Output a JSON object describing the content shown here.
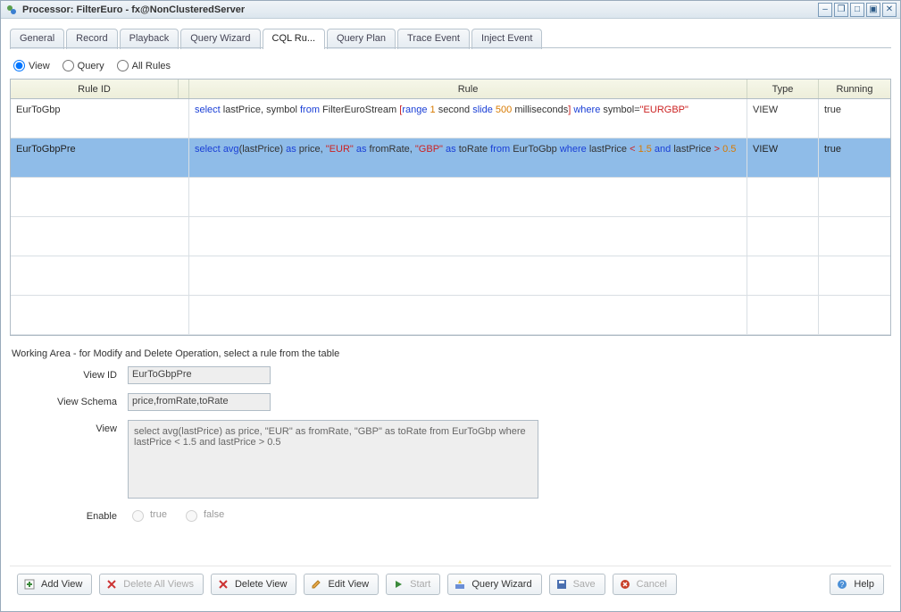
{
  "window": {
    "title": "Processor: FilterEuro - fx@NonClusteredServer"
  },
  "tabs": [
    {
      "label": "General"
    },
    {
      "label": "Record"
    },
    {
      "label": "Playback"
    },
    {
      "label": "Query Wizard"
    },
    {
      "label": "CQL Ru...",
      "active": true
    },
    {
      "label": "Query Plan"
    },
    {
      "label": "Trace Event"
    },
    {
      "label": "Inject Event"
    }
  ],
  "filter": {
    "view": "View",
    "query": "Query",
    "all": "All Rules",
    "selected": "view"
  },
  "grid": {
    "headers": {
      "ruleid": "Rule ID",
      "rule": "Rule",
      "type": "Type",
      "running": "Running"
    },
    "rows": [
      {
        "ruleid": "EurToGbp",
        "rule_plain": "select lastPrice, symbol from FilterEuroStream [range 1 second slide 500 milliseconds] where symbol=\"EURGBP\"",
        "type": "VIEW",
        "running": "true",
        "selected": false,
        "tokens": [
          {
            "t": "select",
            "c": "kw-blue"
          },
          {
            "t": " lastPrice, symbol ",
            "c": "kw-black"
          },
          {
            "t": "from",
            "c": "kw-blue"
          },
          {
            "t": " FilterEuroStream ",
            "c": "kw-black"
          },
          {
            "t": "[",
            "c": "kw-red"
          },
          {
            "t": "range",
            "c": "kw-blue"
          },
          {
            "t": " 1 ",
            "c": "kw-orange"
          },
          {
            "t": "second ",
            "c": "kw-black"
          },
          {
            "t": "slide",
            "c": "kw-blue"
          },
          {
            "t": " 500 ",
            "c": "kw-orange"
          },
          {
            "t": "milliseconds",
            "c": "kw-black"
          },
          {
            "t": "]",
            "c": "kw-red"
          },
          {
            "t": " ",
            "c": "kw-black"
          },
          {
            "t": "where",
            "c": "kw-blue"
          },
          {
            "t": " symbol=",
            "c": "kw-black"
          },
          {
            "t": "\"EURGBP\"",
            "c": "kw-red"
          }
        ]
      },
      {
        "ruleid": "EurToGbpPre",
        "rule_plain": "select avg(lastPrice) as price, \"EUR\" as fromRate, \"GBP\" as toRate from EurToGbp where lastPrice < 1.5 and lastPrice > 0.5",
        "type": "VIEW",
        "running": "true",
        "selected": true,
        "tokens": [
          {
            "t": "select",
            "c": "kw-blue"
          },
          {
            "t": " ",
            "c": "kw-black"
          },
          {
            "t": "avg",
            "c": "kw-blue"
          },
          {
            "t": "(lastPrice) ",
            "c": "kw-black"
          },
          {
            "t": "as",
            "c": "kw-blue"
          },
          {
            "t": " price, ",
            "c": "kw-black"
          },
          {
            "t": "\"EUR\"",
            "c": "kw-red"
          },
          {
            "t": " ",
            "c": "kw-black"
          },
          {
            "t": "as",
            "c": "kw-blue"
          },
          {
            "t": " fromRate, ",
            "c": "kw-black"
          },
          {
            "t": "\"GBP\"",
            "c": "kw-red"
          },
          {
            "t": " ",
            "c": "kw-black"
          },
          {
            "t": "as",
            "c": "kw-blue"
          },
          {
            "t": " toRate ",
            "c": "kw-black"
          },
          {
            "t": "from",
            "c": "kw-blue"
          },
          {
            "t": " EurToGbp ",
            "c": "kw-black"
          },
          {
            "t": "where",
            "c": "kw-blue"
          },
          {
            "t": " lastPrice ",
            "c": "kw-black"
          },
          {
            "t": "<",
            "c": "kw-red"
          },
          {
            "t": " 1.5 ",
            "c": "kw-orange"
          },
          {
            "t": "and",
            "c": "kw-blue"
          },
          {
            "t": " lastPrice ",
            "c": "kw-black"
          },
          {
            "t": ">",
            "c": "kw-red"
          },
          {
            "t": " 0.5",
            "c": "kw-orange"
          }
        ]
      }
    ],
    "empty_rows": 4
  },
  "working_area": {
    "caption": "Working Area - for Modify and Delete Operation, select a rule from the table",
    "labels": {
      "view_id": "View ID",
      "view_schema": "View Schema",
      "view": "View",
      "enable": "Enable",
      "true": "true",
      "false": "false"
    },
    "values": {
      "view_id": "EurToGbpPre",
      "view_schema": "price,fromRate,toRate",
      "view_text": "select avg(lastPrice) as price, \"EUR\" as fromRate, \"GBP\" as toRate from EurToGbp where lastPrice < 1.5 and lastPrice > 0.5"
    }
  },
  "buttons": {
    "add_view": "Add View",
    "delete_all": "Delete All Views",
    "delete_view": "Delete View",
    "edit_view": "Edit View",
    "start": "Start",
    "querywiz": "Query Wizard",
    "save": "Save",
    "cancel": "Cancel",
    "help": "Help"
  }
}
